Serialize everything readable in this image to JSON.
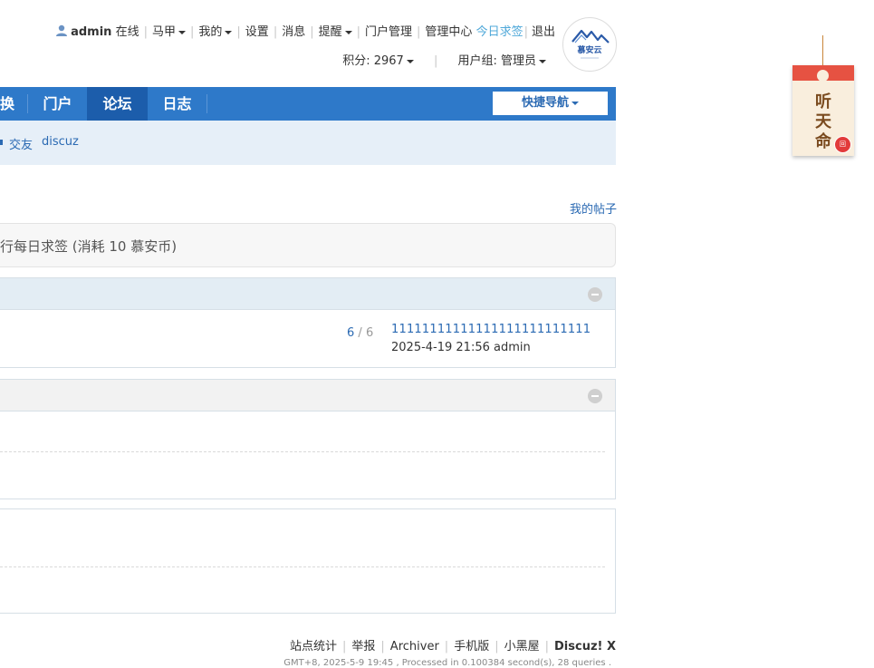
{
  "topbar": {
    "username": "admin",
    "status": "在线",
    "items": [
      "马甲",
      "我的",
      "设置",
      "消息",
      "提醒",
      "门户管理",
      "管理中心"
    ],
    "signin": "今日求签",
    "logout": "退出"
  },
  "subbar": {
    "points_label": "积分: 2967",
    "usergroup_label": "用户组: 管理员"
  },
  "logo": {
    "text": "慕安云"
  },
  "nav": {
    "partial_item": "换",
    "items": [
      "门户",
      "论坛",
      "日志"
    ],
    "active": "论坛",
    "quick_nav": "快捷导航"
  },
  "subnav": {
    "links": [
      "交友",
      "discuz"
    ]
  },
  "my_posts": "我的帖子",
  "sign_notice": "行每日求签 (消耗 10 慕安币)",
  "forum": {
    "threads": "6",
    "posts": "6",
    "last_post_title": "11111111111111111111111111",
    "last_post_meta": "2025-4-19 21:56 admin"
  },
  "footer": {
    "links": [
      "站点统计",
      "举报",
      "Archiver",
      "手机版",
      "小黑屋"
    ],
    "brand": "Discuz! X",
    "info": "GMT+8, 2025-5-9 19:45 , Processed in 0.100384 second(s), 28 queries ."
  },
  "charm": {
    "text": "听天命",
    "badge": "回"
  },
  "colors": {
    "nav_bg": "#2e79c9",
    "nav_active": "#1c5dab",
    "link": "#2b6ab3",
    "signin": "#4fa8d9",
    "charm_red": "#e65242"
  }
}
